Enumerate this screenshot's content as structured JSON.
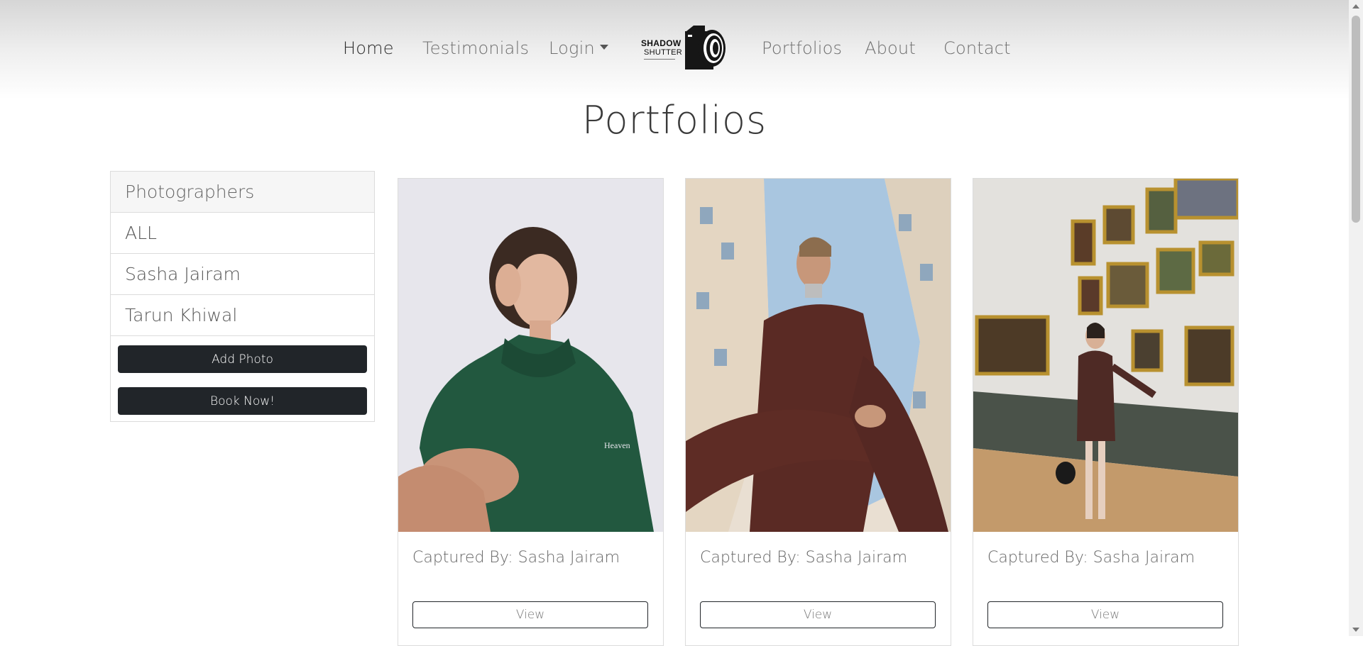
{
  "nav": {
    "links": [
      "Home",
      "Testimonials",
      "Login",
      "Portfolios",
      "About",
      "Contact"
    ],
    "active": "Home",
    "logo": {
      "line1": "SHADOW",
      "line2": "SHUTTER",
      "icon": "camera-icon"
    }
  },
  "page": {
    "title": "Portfolios"
  },
  "sidebar": {
    "header": "Photographers",
    "items": [
      "ALL",
      "Sasha Jairam",
      "Tarun Khiwal"
    ],
    "add_photo": "Add Photo",
    "book_now": "Book Now!"
  },
  "cards": [
    {
      "caption": "Captured By: Sasha Jairam",
      "button": "View"
    },
    {
      "caption": "Captured By: Sasha Jairam",
      "button": "View"
    },
    {
      "caption": "Captured By: Sasha Jairam",
      "button": "View"
    }
  ],
  "colors": {
    "dark_button": "#212529",
    "border": "#dcdcdc",
    "nav_gradient_top": "#d6d6d6"
  }
}
